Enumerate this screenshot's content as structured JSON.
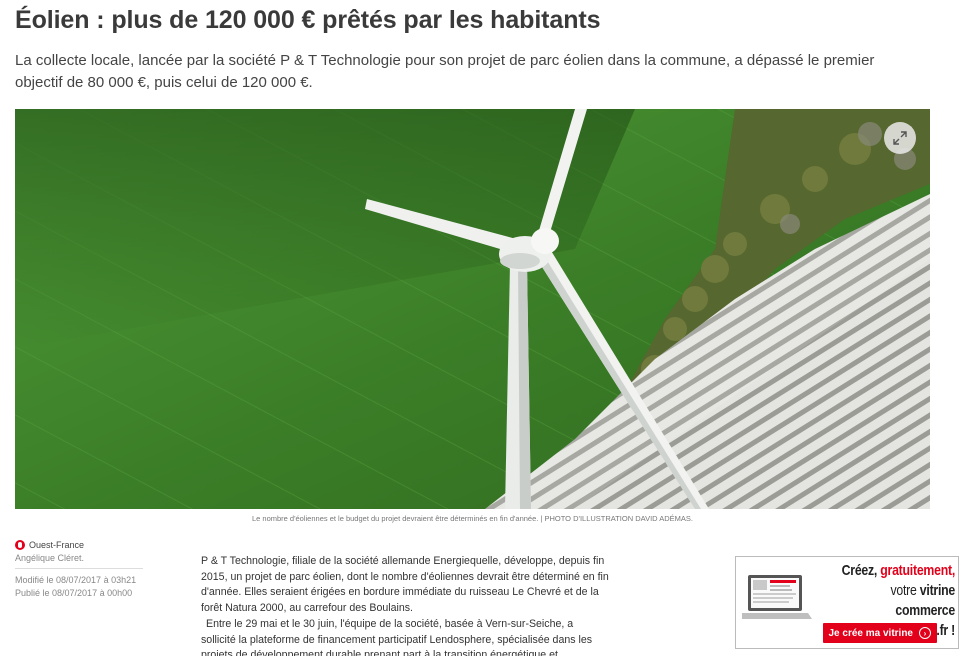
{
  "article": {
    "headline": "Éolien : plus de 120 000 € prêtés par les habitants",
    "standfirst": "La collecte locale, lancée par la société P & T Technologie pour son projet de parc éolien dans la commune, a dépassé le premier objectif de 80 000 €, puis celui de 120 000 €.",
    "caption": "Le nombre d'éoliennes et le budget du projet devraient être déterminés en fin d'année. | PHOTO D'ILLUSTRATION DAVID ADÉMAS.",
    "body": [
      "P & T Technologie, filiale de la société allemande Energiequelle, développe, depuis fin 2015, un projet de parc éolien, dont le nombre d'éoliennes devrait être déterminé en fin d'année. Elles seraient érigées en bordure immédiate du ruisseau Le Chevré et de la forêt Natura 2000, au carrefour des Boulains.",
      "Entre le 29 mai et le 30 juin, l'équipe de la société, basée à Vern-sur-Seiche, a sollicité la plateforme de financement participatif Lendosphere, spécialisée dans les projets de développement durable prenant part à la transition énergétique et"
    ]
  },
  "meta": {
    "source": "Ouest-France",
    "author": "Angélique Cléret.",
    "modified": "Modifié le 08/07/2017 à 03h21",
    "published": "Publié le 08/07/2017 à 00h00"
  },
  "icons": {
    "expand": "expand-icon",
    "source_logo": "ouest-france-logo-icon"
  },
  "ad": {
    "line1": "Créez, ",
    "line1_red": "gratuitement,",
    "line2_pre": "votre ",
    "line2_bold": "vitrine commerce",
    "line3_pre": "sur ",
    "line3_bold": "ouest-france.fr !",
    "cta": "Je crée ma vitrine",
    "accent": "#e2001a"
  }
}
